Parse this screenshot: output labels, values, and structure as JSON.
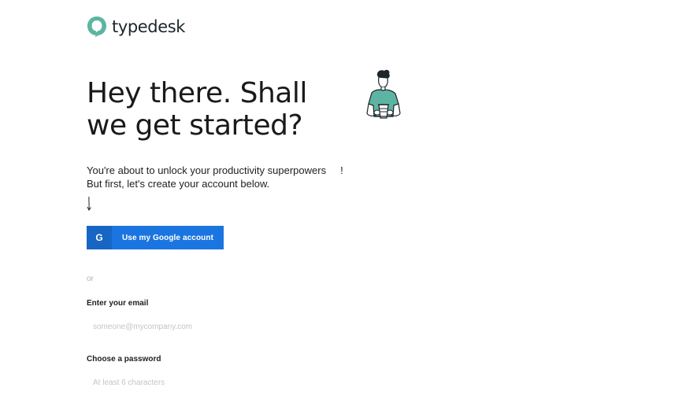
{
  "brand": {
    "name": "typedesk",
    "logo_icon": "speech-bubble-logo",
    "accent_color": "#5eb4a2"
  },
  "headline": "Hey there. Shall we get started?",
  "intro": {
    "line1": "You're about to unlock your productivity superpowers",
    "line1_end": "!",
    "line2": "But first, let's create your account below."
  },
  "google_button": {
    "label": "Use my Google account",
    "icon_glyph": "G",
    "color": "#1b75e0"
  },
  "divider_text": "or",
  "email": {
    "label": "Enter your email",
    "placeholder": "someone@mycompany.com",
    "value": ""
  },
  "password": {
    "label": "Choose a password",
    "placeholder": "At least 6 characters",
    "value": ""
  }
}
